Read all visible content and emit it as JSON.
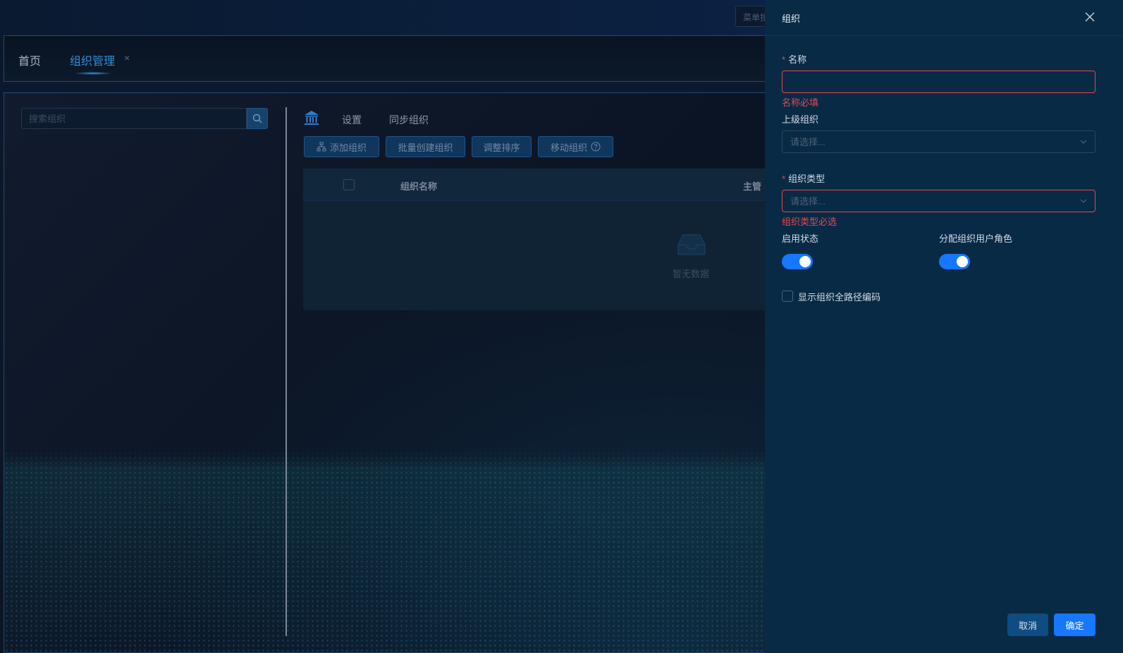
{
  "header": {
    "menu_search_placeholder": "菜单搜索"
  },
  "tabs": [
    {
      "label": "首页",
      "active": false
    },
    {
      "label": "组织管理",
      "active": true,
      "closable": true
    }
  ],
  "tab_close_glyph": "×",
  "left_panel": {
    "search_placeholder": "搜索组织",
    "search_icon": "search-icon"
  },
  "toolbar": {
    "home_icon": "bank-icon",
    "links": [
      "设置",
      "同步组织"
    ],
    "buttons": {
      "add": "添加组织",
      "batch_create": "批量创建组织",
      "sort": "调整排序",
      "move": "移动组织"
    }
  },
  "table": {
    "columns": [
      "组织名称",
      "主管"
    ],
    "empty_text": "暂无数据"
  },
  "drawer": {
    "title": "组织",
    "name_label": "名称",
    "name_value": "",
    "name_error": "名称必填",
    "parent_label": "上级组织",
    "parent_placeholder": "请选择...",
    "type_label": "组织类型",
    "type_placeholder": "请选择...",
    "type_error": "组织类型必选",
    "enable_label": "启用状态",
    "enable_on": true,
    "assign_role_label": "分配组织用户角色",
    "assign_role_on": true,
    "fullpath_label": "显示组织全路径编码",
    "fullpath_checked": false,
    "cancel_label": "取消",
    "ok_label": "确定",
    "required_mark": "*"
  },
  "colors": {
    "accent": "#1677ff",
    "error": "#e5484d",
    "drawer_bg": "#082a45",
    "tab_active": "#2f8fd8"
  }
}
